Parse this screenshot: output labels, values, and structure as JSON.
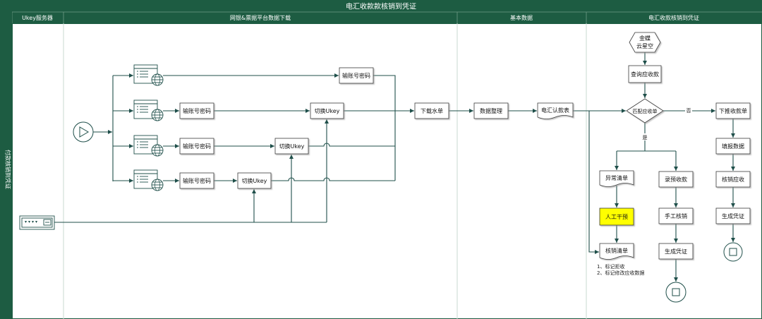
{
  "title": "电汇收款款核销到凭证",
  "lane_label": "付款核销到凭证",
  "columns": [
    "Ukey服务器",
    "网银&票据平台数据下载",
    "基本数据",
    "电汇收款核销到凭证"
  ],
  "download_lane": {
    "branch1": {
      "password": "输账号密码"
    },
    "branch2": {
      "password": "输账号密码",
      "ukey": "切换Ukey"
    },
    "branch3": {
      "password": "输账号密码",
      "ukey": "切换Ukey"
    },
    "branch4": {
      "password": "输账号密码",
      "ukey": "切换Ukey"
    },
    "download": "下载水单"
  },
  "basic_lane": {
    "organize": "数据整理",
    "remittance_sheet": "电汇认款表"
  },
  "writeoff_lane": {
    "erp": [
      "金蝶",
      "云星空"
    ],
    "query_receivable": "查询应收款",
    "match_receivable": "匹配应收单",
    "no_label": "否",
    "yes_label": "是",
    "push_receipt": "下推收款单",
    "fill_data": "填报数据",
    "writeoff_receivable": "核销应收",
    "generate_voucher_right": "生成凭证",
    "exception_list": "异常清单",
    "manual_intervention": "人工干预",
    "writeoff_list": "核销清单",
    "notes": [
      "1、标记拒收",
      "2、标记修改应收数据"
    ],
    "record_prepayment": "录预收款",
    "manual_writeoff": "手工核销",
    "generate_voucher_middle": "生成凭证"
  },
  "icons": {
    "start": "play-icon",
    "end": "stop-icon",
    "platform": "web-platform-icon",
    "globe": "globe-icon",
    "server": "ukey-server-icon"
  },
  "colors": {
    "header": "#1d5c42",
    "line": "#1f4f4a",
    "highlight": "#ffff00"
  }
}
